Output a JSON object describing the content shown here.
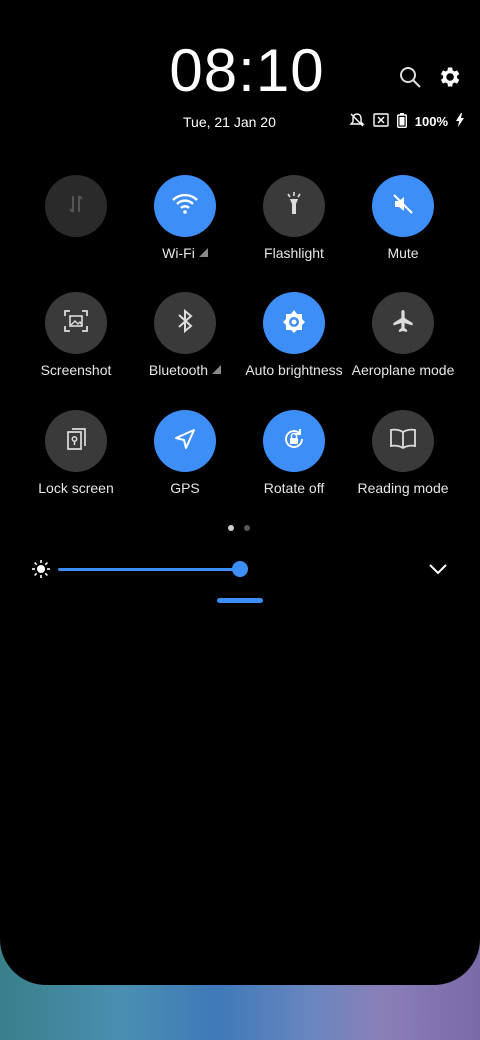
{
  "clock": {
    "time": "08:10",
    "date": "Tue, 21 Jan 20"
  },
  "status": {
    "battery": "100%"
  },
  "tiles": [
    {
      "label": "",
      "state": "disabled",
      "icon": "mobile-data-icon"
    },
    {
      "label": "Wi-Fi",
      "state": "on",
      "icon": "wifi-icon",
      "has_signal": true
    },
    {
      "label": "Flashlight",
      "state": "off",
      "icon": "flashlight-icon"
    },
    {
      "label": "Mute",
      "state": "on",
      "icon": "mute-icon"
    },
    {
      "label": "Screenshot",
      "state": "off",
      "icon": "screenshot-icon"
    },
    {
      "label": "Bluetooth",
      "state": "off",
      "icon": "bluetooth-icon",
      "has_signal": true
    },
    {
      "label": "Auto brightness",
      "state": "on",
      "icon": "auto-brightness-icon"
    },
    {
      "label": "Aeroplane mode",
      "state": "off",
      "icon": "airplane-icon"
    },
    {
      "label": "Lock screen",
      "state": "off",
      "icon": "lock-screen-icon"
    },
    {
      "label": "GPS",
      "state": "on",
      "icon": "gps-icon"
    },
    {
      "label": "Rotate off",
      "state": "on",
      "icon": "rotate-lock-icon"
    },
    {
      "label": "Reading mode",
      "state": "off",
      "icon": "reading-mode-icon"
    }
  ],
  "pagination": {
    "current": 1,
    "total": 2
  },
  "brightness": {
    "level": 0.87
  },
  "colors": {
    "accent": "#3e8ef7",
    "tile_off": "#3a3a3a",
    "background": "#000000"
  }
}
